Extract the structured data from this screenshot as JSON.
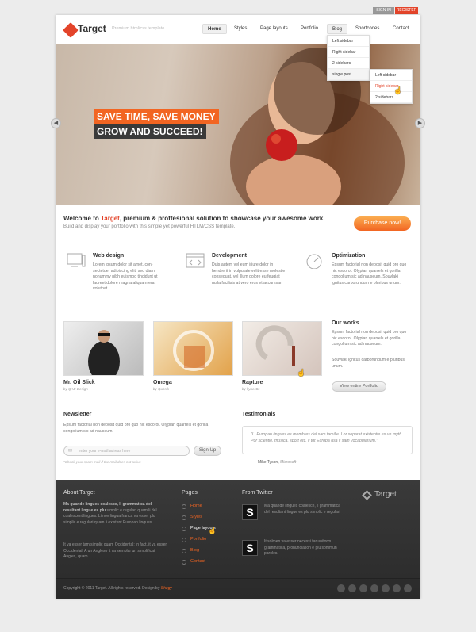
{
  "top_links": {
    "sign_in": "SIGN IN",
    "register": "REGISTER"
  },
  "header": {
    "brand": "Target",
    "tagline": "Premium html/css template"
  },
  "nav": [
    "Home",
    "Styles",
    "Page layouts",
    "Portfolio",
    "Blog",
    "Shortcodes",
    "Contact"
  ],
  "blog_menu": [
    "Left sidebar",
    "Right sidebar",
    "2 sidebars",
    "single post"
  ],
  "single_post_menu": [
    "Left sidebar",
    "Right sidebar",
    "2 sidebars"
  ],
  "hero": {
    "line1": "SAVE TIME, SAVE MONEY",
    "line2": "GROW AND SUCCEED!"
  },
  "welcome": {
    "prefix": "Welcome to ",
    "brand": "Target",
    "suffix": ", premium & proffesional solution to showcase your awesome work.",
    "sub": "Build and display your portfolio with this simple yet powerful HTLM/CSS template.",
    "cta": "Purchase now!"
  },
  "features": [
    {
      "title": "Web design",
      "text": "Lorem ipsum dolor sit amet, con-sectetuer adipiscing elit, sed diam nonummy nibh euismod tincidunt ut laoreet dolore magna aliquam erat volutpat."
    },
    {
      "title": "Development",
      "text": "Duis autem vel eum iriure dolor in hendrerit in vulputate velit esse molestie consequat, vel illum dolore eu feugiat nulla facilisis at vero eros et accumsan"
    },
    {
      "title": "Optimization",
      "text": "Epsum factorial non deposit quid pro quo hic escorol. Olypian quarrels et gorilla congolium sic ad nauseum. Souvlaki ignitus carborundum e pluribus unum."
    }
  ],
  "portfolio": [
    {
      "title": "Mr. Oil Slick",
      "by": "by QAE Design"
    },
    {
      "title": "Omega",
      "by": "by Qubsik"
    },
    {
      "title": "Rapture",
      "by": "by kynecttc"
    }
  ],
  "our_works": {
    "title": "Our works",
    "text1": "Epsum factorial non deposit quid pro quo hic escorol. Olypian quarrels et gorilla congolium sic ad nauseum.",
    "text2": "Souvlaki ignitus carborundum e pluribus unum.",
    "button": "View entire Portfolio"
  },
  "newsletter": {
    "title": "Newsletter",
    "text": "Epsum factorial non deposit quid pro quo hic escorol. Olypian quarrels et gorilla congolium sic ad nauseum.",
    "placeholder": "enter your e-mail adress here",
    "button": "Sign Up",
    "note": "*Check your spam mail if the mail does not arrive"
  },
  "testimonials": {
    "title": "Testimonials",
    "quote": "\"Li Europan lingues es membres del sam familie. Lor separat existentie es un myth. Por scientie, musica, sport etc, li tot Europa usa li sam vocabularium.\"",
    "author": "Mike Tyson,",
    "company": " Microsoft"
  },
  "footer": {
    "about_title": "About Target",
    "about_bold": "Ma quande lingues coalesce, li grammatica del resultant lingue es plu",
    "about_text": " simplic e regulari quam li del coalescent lingues. Li nov lingua franca va esser plu simplic e regulari quam li existent Europan lingues.",
    "about_text2": "It va esser tam simplic quam Occidental: in fact, it va esser Occidental. A un Angleso it va semblar un simplificat Angles, quam.",
    "pages_title": "Pages",
    "pages": [
      "Home",
      "Styles",
      "Page layouts",
      "Portfolio",
      "Blog",
      "Contact"
    ],
    "twitter_title": "From Twitter",
    "tweet1": "Ma quande lingues coalesce, li grammatica del resultant lingue es plu simplic e regulari",
    "tweet2": "It solmen va esser necessi far uniform grammatica, pronunciation e plu sommun paroles.",
    "brand": "Target",
    "copyright": "Copyright © 2011 Target. All rights reserved. Design by ",
    "designer": "Shegy"
  },
  "colors": {
    "accent": "#f26522",
    "brand_red": "#e3442a",
    "footer_bg": "#333333"
  }
}
